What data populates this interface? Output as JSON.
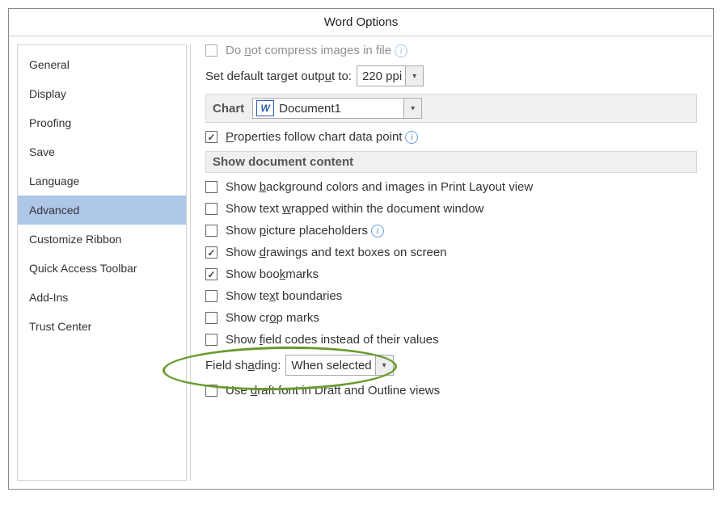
{
  "dialog": {
    "title": "Word Options"
  },
  "sidebar": {
    "items": [
      {
        "label": "General"
      },
      {
        "label": "Display"
      },
      {
        "label": "Proofing"
      },
      {
        "label": "Save"
      },
      {
        "label": "Language"
      },
      {
        "label": "Advanced",
        "selected": true
      },
      {
        "label": "Customize Ribbon"
      },
      {
        "label": "Quick Access Toolbar"
      },
      {
        "label": "Add-Ins"
      },
      {
        "label": "Trust Center"
      }
    ]
  },
  "content": {
    "compress_label": "Do not compress images in file",
    "target_output_label": "Set default target output to:",
    "target_output_value": "220 ppi",
    "chart_section_label": "Chart",
    "chart_document": "Document1",
    "chart_prop_label": "Properties follow chart data point",
    "show_section": "Show document content",
    "opts": {
      "bg": "Show background colors and images in Print Layout view",
      "wrap": "Show text wrapped within the document window",
      "pic": "Show picture placeholders",
      "draw": "Show drawings and text boxes on screen",
      "bm": "Show bookmarks",
      "bound": "Show text boundaries",
      "crop": "Show crop marks",
      "field": "Show field codes instead of their values",
      "shade_label": "Field shading:",
      "shade_value": "When selected",
      "draft": "Use draft font in Draft and Outline views"
    }
  }
}
